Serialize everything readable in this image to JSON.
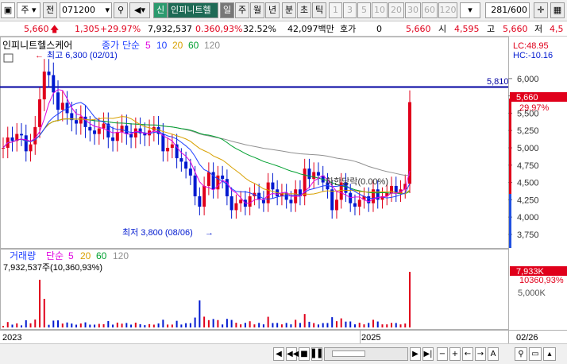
{
  "toolbar": {
    "market": "주",
    "all_label": "전",
    "code": "071200",
    "new_badge": "신",
    "stock_name": "인피니트헬",
    "period_day": "일",
    "period_week": "주",
    "period_month": "월",
    "period_year": "년",
    "period_minute": "분",
    "period_second": "초",
    "period_tick": "틱",
    "intervals": [
      "1",
      "3",
      "5",
      "10",
      "20",
      "30",
      "60",
      "120"
    ],
    "count": "281",
    "count_total": "/600"
  },
  "quote": {
    "price": "5,660",
    "change": "1,305",
    "change_pct": "+29.97%",
    "volume": "7,932,537",
    "volume_ratio": "0.360,93%",
    "turnover": "32.52%",
    "amount": "42,097백만",
    "bid_label": "호가",
    "bid_value": "0",
    "ask_value": "5,660",
    "open_label": "시",
    "open_value": "4,595",
    "high_label": "고",
    "high_value": "5,660",
    "low_label": "저",
    "low_value": "4,5"
  },
  "chart_data": {
    "type": "line",
    "title": "인피니트헬스케어",
    "price_legend": [
      "종가",
      "단순",
      "5",
      "10",
      "20",
      "60",
      "120"
    ],
    "volume_legend": [
      "거래량",
      "단순",
      "5",
      "20",
      "60",
      "120"
    ],
    "colors": {
      "up": "#e0001b",
      "down": "#0019d0",
      "ma5": "#e000e0",
      "ma10": "#2040ff",
      "ma20": "#d8a000",
      "ma60": "#00a030",
      "ma120": "#909090",
      "hline": "#0000a0"
    },
    "y_ticks": [
      "6,000",
      "5,750",
      "5,500",
      "5,250",
      "5,000",
      "4,750",
      "4,500",
      "4,250",
      "4,000",
      "3,750"
    ],
    "y_range": [
      3600,
      6400
    ],
    "lc": "LC:48.95",
    "hc": "HC:-10.16",
    "hline_value": "5,810",
    "last_price_label": "5,660",
    "last_pct_label": "29.97%",
    "high_annotation": "최고 6,300 (02/01)",
    "low_annotation": "최저 3,800 (08/06)",
    "limit_annotation": "하한당락(0.00%)",
    "volume_info": "7,932,537주(10,360,93%)",
    "volume_tick": "5,000K",
    "volume_last": "7,933K",
    "volume_last_pct": "10360,93%",
    "x_labels": [
      "2023",
      "2025"
    ],
    "date_label": "02/26",
    "closes": [
      5000,
      5150,
      5100,
      5200,
      5180,
      4950,
      5050,
      5300,
      5700,
      6100,
      6050,
      5800,
      5550,
      5650,
      5500,
      5400,
      5350,
      5450,
      5300,
      5250,
      5200,
      5280,
      5350,
      5150,
      5100,
      5230,
      5320,
      5200,
      5150,
      5280,
      5210,
      5180,
      5250,
      5300,
      5200,
      4950,
      5000,
      5050,
      4850,
      4800,
      4700,
      4600,
      4300,
      4150,
      4450,
      4650,
      4400,
      4600,
      4550,
      4300,
      4100,
      4200,
      4250,
      4150,
      4300,
      4350,
      4250,
      4200,
      4500,
      4400,
      4300,
      4350,
      4250,
      4200,
      4400,
      4300,
      4700,
      4550,
      4650,
      4600,
      4500,
      4400,
      4100,
      4250,
      4500,
      4350,
      4200,
      4150,
      4250,
      4300,
      4200,
      4400,
      4250,
      4300,
      4350,
      4450,
      4350,
      4400,
      4480,
      5660
    ]
  },
  "bottom": {
    "nav_first": "◀",
    "nav_stop": "■",
    "nav_pause": "▌▌",
    "nav_next": "▶",
    "zoom_out": "−",
    "zoom_in": "+",
    "font_label": "A"
  }
}
